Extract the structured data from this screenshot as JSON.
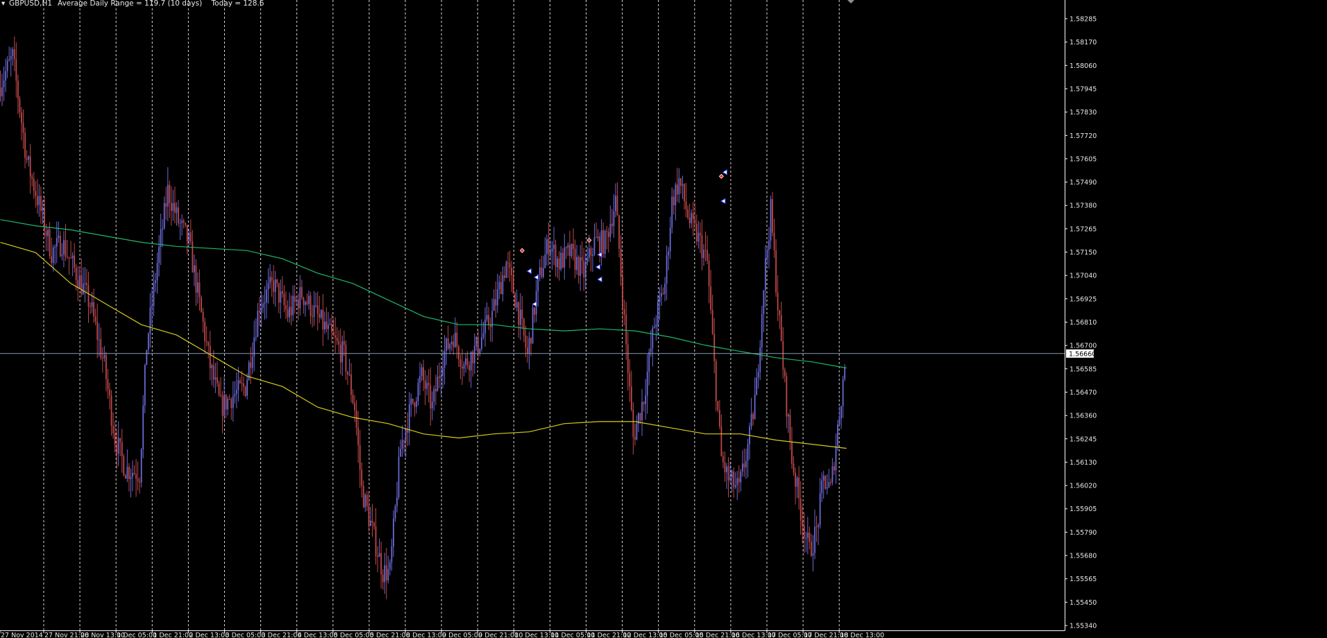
{
  "header": {
    "symbol": "GBPUSD,H1",
    "indicator": "Average Daily Range = 119.7 (10 days)    Today = 128.6"
  },
  "price_axis": {
    "ticks": [
      "1.58285",
      "1.58170",
      "1.58060",
      "1.57945",
      "1.57830",
      "1.57720",
      "1.57605",
      "1.57490",
      "1.57380",
      "1.57265",
      "1.57150",
      "1.57040",
      "1.56925",
      "1.56810",
      "1.56700",
      "1.56585",
      "1.56470",
      "1.56360",
      "1.56245",
      "1.56130",
      "1.56020",
      "1.55905",
      "1.55790",
      "1.55680",
      "1.55565",
      "1.55450",
      "1.55340"
    ],
    "current_price": "1.56660"
  },
  "colors": {
    "background": "#000000",
    "axis": "#ffffff",
    "grid": "#ffffff",
    "bull_candle": "#6a6ad8",
    "bear_candle": "#c04848",
    "ma_fast": "#d8cc1c",
    "ma_slow": "#1fb86c",
    "bid_line": "#8a9ab4",
    "buy_arrow": "#3a4aff",
    "sell_arrow": "#ff2020"
  },
  "chart_data": {
    "type": "candlestick",
    "symbol": "GBPUSD",
    "timeframe": "H1",
    "time_axis_labels": [
      "27 Nov 2014",
      "27 Nov 21:00",
      "28 Nov 13:00",
      "1 Dec 05:00",
      "1 Dec 21:00",
      "2 Dec 13:00",
      "3 Dec 05:00",
      "3 Dec 21:00",
      "4 Dec 13:00",
      "5 Dec 05:00",
      "5 Dec 21:00",
      "8 Dec 13:00",
      "9 Dec 05:00",
      "9 Dec 21:00",
      "10 Dec 13:00",
      "11 Dec 05:00",
      "11 Dec 21:00",
      "12 Dec 13:00",
      "15 Dec 05:00",
      "15 Dec 21:00",
      "16 Dec 13:00",
      "17 Dec 05:00",
      "17 Dec 21:00",
      "18 Dec 13:00"
    ],
    "ylim": [
      1.5534,
      1.58285
    ],
    "grid": "vertical dashed, one line per time label",
    "close_path": [
      [
        0,
        1.5795
      ],
      [
        8,
        1.581
      ],
      [
        16,
        1.576
      ],
      [
        24,
        1.5735
      ],
      [
        30,
        1.5715
      ],
      [
        36,
        1.572
      ],
      [
        44,
        1.5705
      ],
      [
        52,
        1.569
      ],
      [
        60,
        1.566
      ],
      [
        66,
        1.5625
      ],
      [
        72,
        1.561
      ],
      [
        80,
        1.5608
      ],
      [
        84,
        1.567
      ],
      [
        90,
        1.571
      ],
      [
        96,
        1.5745
      ],
      [
        102,
        1.573
      ],
      [
        108,
        1.572
      ],
      [
        114,
        1.569
      ],
      [
        120,
        1.566
      ],
      [
        126,
        1.564
      ],
      [
        132,
        1.5645
      ],
      [
        140,
        1.565
      ],
      [
        148,
        1.569
      ],
      [
        156,
        1.57
      ],
      [
        164,
        1.5685
      ],
      [
        172,
        1.5695
      ],
      [
        180,
        1.5685
      ],
      [
        188,
        1.5675
      ],
      [
        196,
        1.5665
      ],
      [
        202,
        1.564
      ],
      [
        206,
        1.56
      ],
      [
        212,
        1.558
      ],
      [
        218,
        1.556
      ],
      [
        222,
        1.556
      ],
      [
        228,
        1.562
      ],
      [
        234,
        1.564
      ],
      [
        240,
        1.5655
      ],
      [
        246,
        1.564
      ],
      [
        252,
        1.5665
      ],
      [
        258,
        1.5675
      ],
      [
        264,
        1.566
      ],
      [
        272,
        1.567
      ],
      [
        280,
        1.5685
      ],
      [
        288,
        1.571
      ],
      [
        294,
        1.569
      ],
      [
        300,
        1.5665
      ],
      [
        306,
        1.57
      ],
      [
        312,
        1.572
      ],
      [
        318,
        1.571
      ],
      [
        324,
        1.5715
      ],
      [
        332,
        1.5705
      ],
      [
        338,
        1.572
      ],
      [
        344,
        1.572
      ],
      [
        350,
        1.574
      ],
      [
        356,
        1.567
      ],
      [
        360,
        1.5625
      ],
      [
        366,
        1.5645
      ],
      [
        372,
        1.568
      ],
      [
        378,
        1.57
      ],
      [
        382,
        1.574
      ],
      [
        386,
        1.575
      ],
      [
        392,
        1.573
      ],
      [
        398,
        1.572
      ],
      [
        402,
        1.571
      ],
      [
        406,
        1.566
      ],
      [
        410,
        1.5615
      ],
      [
        414,
        1.5605
      ],
      [
        420,
        1.56
      ],
      [
        426,
        1.5625
      ],
      [
        430,
        1.565
      ],
      [
        434,
        1.57
      ],
      [
        438,
        1.5735
      ],
      [
        442,
        1.569
      ],
      [
        446,
        1.565
      ],
      [
        450,
        1.5615
      ],
      [
        456,
        1.5585
      ],
      [
        460,
        1.557
      ],
      [
        464,
        1.558
      ],
      [
        468,
        1.5605
      ],
      [
        472,
        1.56
      ],
      [
        476,
        1.563
      ],
      [
        480,
        1.566
      ]
    ],
    "series": [
      {
        "values": [
          [
            0,
            1.572
          ],
          [
            20,
            1.5715
          ],
          [
            40,
            1.57
          ],
          [
            60,
            1.569
          ],
          [
            80,
            1.568
          ],
          [
            100,
            1.5675
          ],
          [
            120,
            1.5665
          ],
          [
            140,
            1.5655
          ],
          [
            160,
            1.565
          ],
          [
            180,
            1.564
          ],
          [
            200,
            1.5635
          ],
          [
            220,
            1.5632
          ],
          [
            240,
            1.5627
          ],
          [
            260,
            1.5625
          ],
          [
            280,
            1.5627
          ],
          [
            300,
            1.5628
          ],
          [
            320,
            1.5632
          ],
          [
            340,
            1.5633
          ],
          [
            360,
            1.5633
          ],
          [
            380,
            1.563
          ],
          [
            400,
            1.5627
          ],
          [
            420,
            1.5627
          ],
          [
            440,
            1.5624
          ],
          [
            460,
            1.5622
          ],
          [
            480,
            1.562
          ]
        ]
      },
      {
        "values": [
          [
            0,
            1.5731
          ],
          [
            20,
            1.5728
          ],
          [
            40,
            1.5726
          ],
          [
            60,
            1.5723
          ],
          [
            80,
            1.572
          ],
          [
            100,
            1.5718
          ],
          [
            120,
            1.5717
          ],
          [
            140,
            1.5716
          ],
          [
            160,
            1.5712
          ],
          [
            180,
            1.5705
          ],
          [
            200,
            1.57
          ],
          [
            220,
            1.5692
          ],
          [
            240,
            1.5684
          ],
          [
            260,
            1.568
          ],
          [
            280,
            1.568
          ],
          [
            300,
            1.5678
          ],
          [
            320,
            1.5677
          ],
          [
            340,
            1.5678
          ],
          [
            360,
            1.5677
          ],
          [
            380,
            1.5674
          ],
          [
            400,
            1.567
          ],
          [
            420,
            1.5667
          ],
          [
            440,
            1.5664
          ],
          [
            460,
            1.5662
          ],
          [
            480,
            1.5659
          ]
        ]
      }
    ],
    "trade_markers": [
      {
        "x": 296,
        "price": 1.5716,
        "type": "sell"
      },
      {
        "x": 300,
        "price": 1.5706,
        "type": "buy"
      },
      {
        "x": 304,
        "price": 1.5703,
        "type": "buy"
      },
      {
        "x": 303,
        "price": 1.569,
        "type": "buy"
      },
      {
        "x": 334,
        "price": 1.5721,
        "type": "sell"
      },
      {
        "x": 340,
        "price": 1.5714,
        "type": "buy"
      },
      {
        "x": 339,
        "price": 1.5708,
        "type": "buy"
      },
      {
        "x": 340,
        "price": 1.5702,
        "type": "buy"
      },
      {
        "x": 409,
        "price": 1.5752,
        "type": "sell"
      },
      {
        "x": 411,
        "price": 1.5754,
        "type": "buy"
      },
      {
        "x": 410,
        "price": 1.574,
        "type": "buy"
      }
    ]
  }
}
